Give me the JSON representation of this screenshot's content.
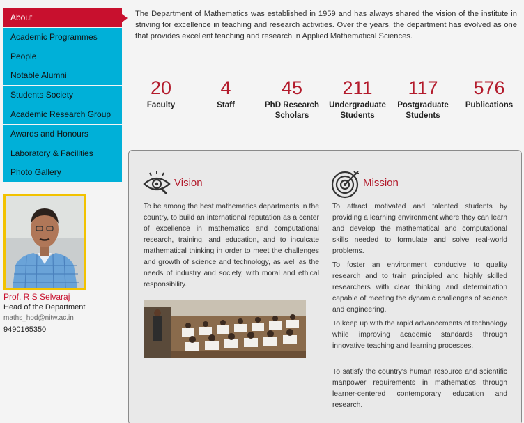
{
  "sidebar": {
    "items": [
      {
        "label": "About",
        "active": true
      },
      {
        "label": "Academic Programmes"
      },
      {
        "label": "People"
      },
      {
        "label": "Notable Alumni"
      },
      {
        "label": "Students Society"
      },
      {
        "label": "Academic Research Group"
      },
      {
        "label": "Awards and Honours"
      },
      {
        "label": "Laboratory & Facilities"
      },
      {
        "label": "Photo Gallery"
      }
    ]
  },
  "hod": {
    "name": "Prof. R S Selvaraj",
    "role": "Head of the Department",
    "email": "maths_hod@nitw.ac.in",
    "phone": "9490165350"
  },
  "intro": "The Department of Mathematics was established in 1959 and has always shared the vision of the institute in striving for excellence in teaching and research activities. Over the years, the department has evolved as one that provides excellent teaching and research in Applied Mathematical Sciences.",
  "stats": [
    {
      "value": "20",
      "label": "Faculty"
    },
    {
      "value": "4",
      "label": "Staff"
    },
    {
      "value": "45",
      "label": "PhD Research Scholars"
    },
    {
      "value": "211",
      "label": "Undergraduate Students"
    },
    {
      "value": "117",
      "label": "Postgraduate Students"
    },
    {
      "value": "576",
      "label": "Publications"
    }
  ],
  "vision": {
    "title": "Vision",
    "icon": "eye-icon",
    "text": "To be among the best mathematics departments in the country, to build an international reputation as a center of excellence in mathematics and computational research, training, and education, and to inculcate mathematical thinking in order to meet the challenges and growth of science and technology, as well as the needs of industry and society, with moral and ethical responsibility."
  },
  "mission": {
    "title": "Mission",
    "icon": "target-icon",
    "paragraphs": [
      "To attract motivated and talented students by providing a learning environment where they can learn and develop the mathematical and computational skills needed to formulate and solve real-world problems.",
      "To foster an environment conducive to quality research and to train principled and highly skilled researchers with clear thinking and determination capable of meeting the dynamic challenges of science and engineering.",
      "To keep up with the rapid advancements of technology while improving academic standards through innovative teaching and learning processes.",
      "To satisfy the country's human resource and scientific manpower requirements in mathematics through learner-centered contemporary education and research."
    ]
  },
  "colors": {
    "accent": "#b31b2c",
    "nav": "#00b0d8",
    "nav_active": "#c8102e",
    "photo_border": "#f2c200"
  }
}
